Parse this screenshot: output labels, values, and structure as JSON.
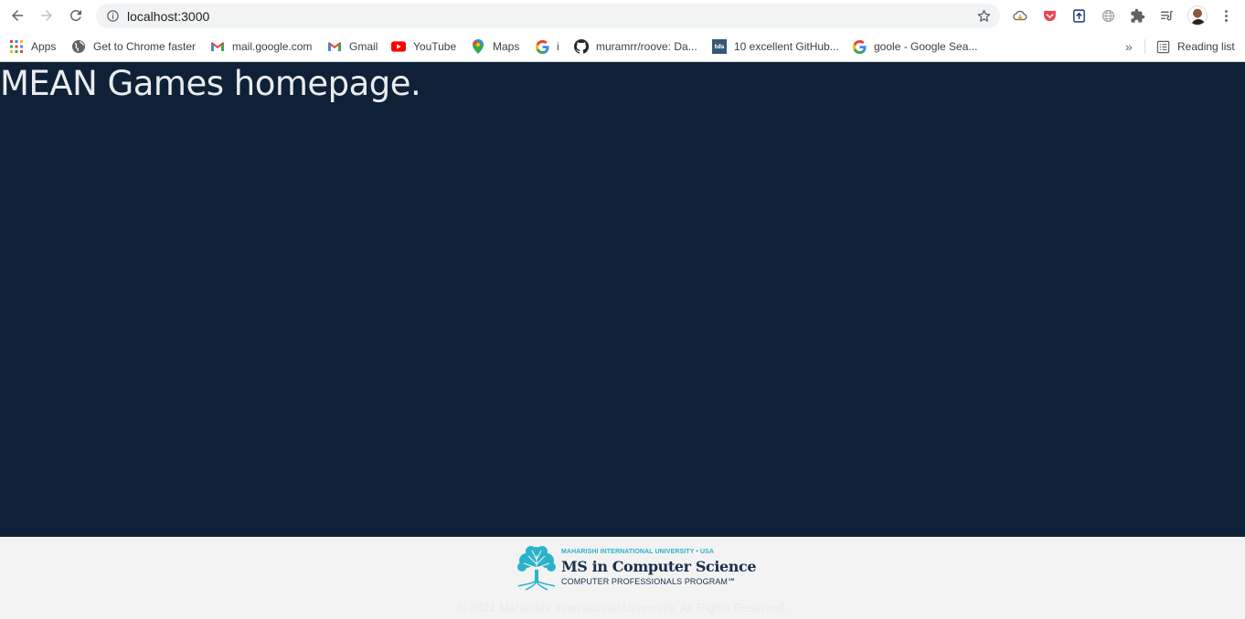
{
  "browser": {
    "url": "localhost:3000",
    "bookmarks": [
      {
        "label": "Apps",
        "icon": "apps-grid-icon"
      },
      {
        "label": "Get to Chrome faster",
        "icon": "chrome-globe-icon"
      },
      {
        "label": "mail.google.com",
        "icon": "gmail-icon"
      },
      {
        "label": "Gmail",
        "icon": "gmail-icon"
      },
      {
        "label": "YouTube",
        "icon": "youtube-icon"
      },
      {
        "label": "Maps",
        "icon": "maps-pin-icon"
      },
      {
        "label": "i",
        "icon": "google-icon"
      },
      {
        "label": "muramrr/roove: Da...",
        "icon": "github-icon"
      },
      {
        "label": "10 excellent GitHub...",
        "icon": "tds-icon"
      },
      {
        "label": "goole - Google Sea...",
        "icon": "google-icon"
      }
    ],
    "reading_list": "Reading list",
    "tds_badge": "tds"
  },
  "page": {
    "title": "MEAN Games homepage."
  },
  "footer": {
    "logo_top": "MAHARISHI INTERNATIONAL UNIVERSITY • USA",
    "logo_main": "MS in Computer Science",
    "logo_sub": "COMPUTER PROFESSIONALS PROGRAM℠",
    "copyright": "© 2021 Maharishi International University. All Rights Reserved."
  },
  "colors": {
    "page_background": "#0f2137",
    "title_text": "#e9ecef",
    "footer_background": "#f3f3f3",
    "logo_teal": "#2bb3c9",
    "logo_navy": "#1a2f4e"
  }
}
